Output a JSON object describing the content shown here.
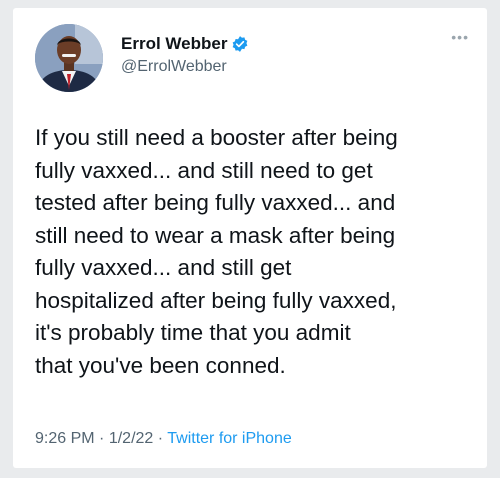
{
  "tweet": {
    "author": {
      "name": "Errol Webber",
      "handle": "@ErrolWebber",
      "avatar_icon": "profile-photo",
      "verified_icon": "verified-badge-icon",
      "verified_color": "#1d9bf0"
    },
    "more_icon": "more-options-icon",
    "text": "If you still need a booster after being\nfully vaxxed... and still need to get\ntested after being fully vaxxed... and\nstill need to wear a mask after being\nfully vaxxed... and still get\nhospitalized after being fully vaxxed,\nit's probably time that you admit\nthat you've been conned.",
    "time": "9:26 PM",
    "separator": "·",
    "date": "1/2/22",
    "source": "Twitter for iPhone"
  }
}
